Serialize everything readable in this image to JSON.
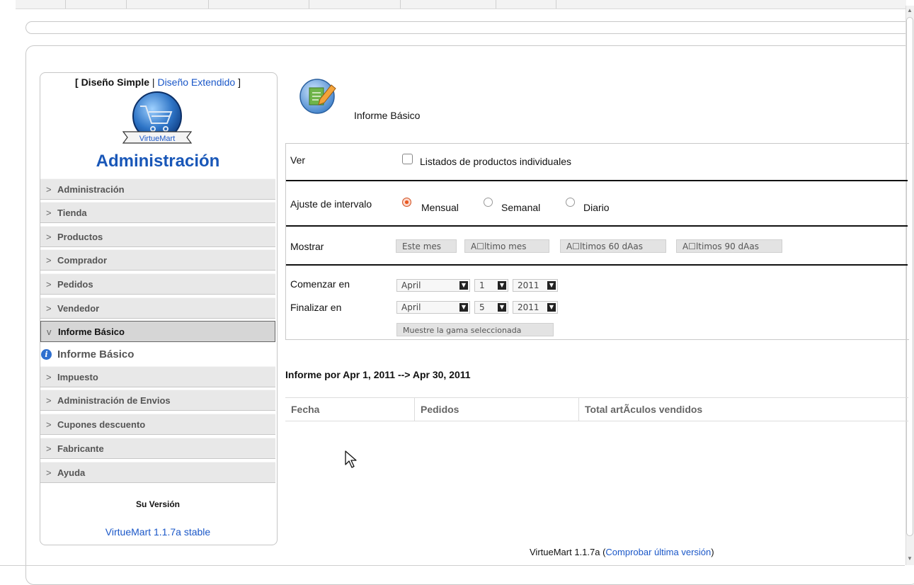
{
  "sidebar": {
    "layout_switch": {
      "open_bracket": "[ ",
      "simple": "Diseño Simple",
      "separator": " | ",
      "extended": "Diseño Extendido",
      "close_bracket": " ]"
    },
    "logo_text": "VirtueMart",
    "title": "Administración",
    "menu": [
      {
        "label": "Administración"
      },
      {
        "label": "Tienda"
      },
      {
        "label": "Productos"
      },
      {
        "label": "Comprador"
      },
      {
        "label": "Pedidos"
      },
      {
        "label": "Vendedor"
      },
      {
        "label": "Informe Básico"
      },
      {
        "label": "Impuesto"
      },
      {
        "label": "Administración de Envios"
      },
      {
        "label": "Cupones descuento"
      },
      {
        "label": "Fabricante"
      },
      {
        "label": "Ayuda"
      }
    ],
    "sub_item": "Informe Básico",
    "version_title": "Su Versión",
    "version_value": "VirtueMart 1.1.7a stable"
  },
  "main": {
    "heading": "Informe Básico",
    "form": {
      "ver_label": "Ver",
      "individual_label": "Listados de productos individuales",
      "interval_label": "Ajuste de intervalo",
      "interval_options": [
        "Mensual",
        "Semanal",
        "Diario"
      ],
      "interval_selected": "Mensual",
      "mostrar_label": "Mostrar",
      "show_buttons": [
        "Este mes",
        "A☐ltimo mes",
        "A☐ltimos 60 dAas",
        "A☐ltimos 90 dAas"
      ],
      "start_label": "Comenzar en",
      "end_label": "Finalizar en",
      "start": {
        "month": "April",
        "day": "1",
        "year": "2011"
      },
      "end": {
        "month": "April",
        "day": "5",
        "year": "2011"
      },
      "range_button": "Muestre la gama seleccionada"
    },
    "report_title": "Informe por Apr 1, 2011 --> Apr 30, 2011",
    "table_headers": [
      "Fecha",
      "Pedidos",
      "Total artÃculos vendidos"
    ]
  },
  "footer": {
    "prefix": "VirtueMart 1.1.7a (",
    "link": "Comprobar última versión",
    "suffix": ")"
  }
}
